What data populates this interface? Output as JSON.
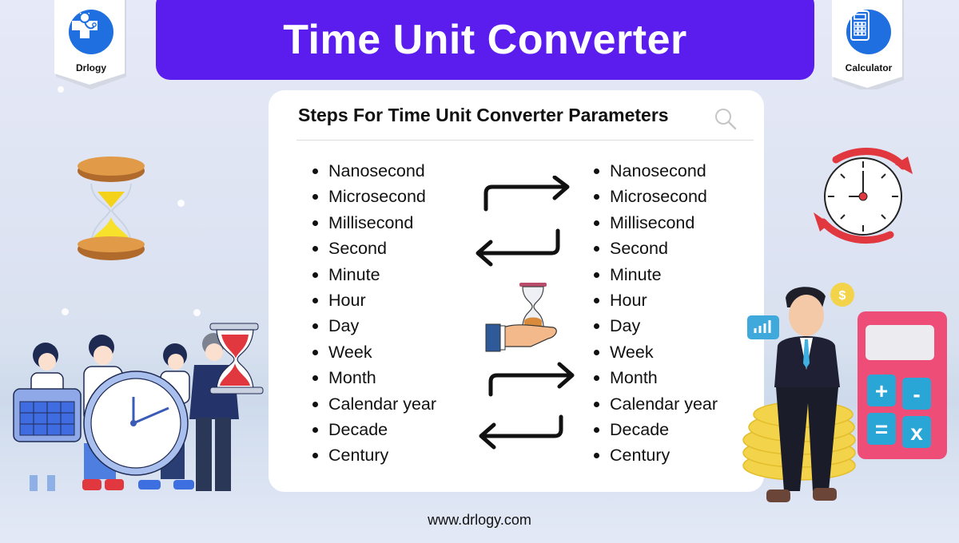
{
  "header": {
    "title": "Time Unit Converter"
  },
  "badges": {
    "left": {
      "label": "Drlogy",
      "icon": "doctor-cross-stethoscope-icon"
    },
    "right": {
      "label": "Calculator",
      "icon": "calculator-icon"
    }
  },
  "card": {
    "title": "Steps For Time Unit Converter Parameters",
    "search_icon": "search-icon",
    "from_units": [
      "Nanosecond",
      "Microsecond",
      "Millisecond",
      "Second",
      "Minute",
      "Hour",
      "Day",
      "Week",
      "Month",
      "Calendar year",
      "Decade",
      "Century"
    ],
    "to_units": [
      "Nanosecond",
      "Microsecond",
      "Millisecond",
      "Second",
      "Minute",
      "Hour",
      "Day",
      "Week",
      "Month",
      "Calendar year",
      "Decade",
      "Century"
    ]
  },
  "colors": {
    "banner": "#5b1ded",
    "badge_icon": "#1f6fe0",
    "clock_arrows": "#e0383e",
    "calculator": "#ee4d78",
    "calculator_keys": "#2aa6d6"
  },
  "calculator_keys": [
    "+",
    "-",
    "=",
    "x"
  ],
  "footer": {
    "url": "www.drlogy.com"
  }
}
